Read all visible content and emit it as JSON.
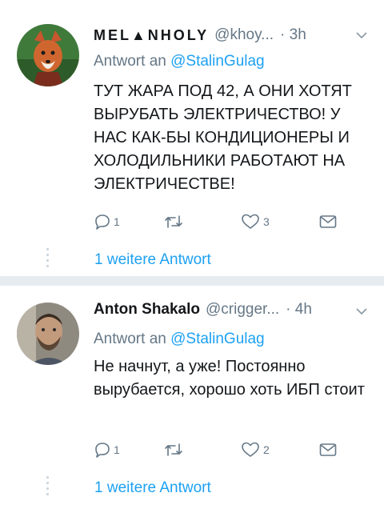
{
  "tweets": [
    {
      "name": "MEL▲NHOLY",
      "handle": "@khoy...",
      "time": "· 3h",
      "reply_prefix": "Antwort an",
      "reply_to": "@StalinGulag",
      "body": "ТУТ ЖАРА ПОД 42, А ОНИ ХОТЯТ ВЫРУБАТЬ ЭЛЕКТРИЧЕСТВО! У НАС КАК-БЫ КОНДИЦИОНЕРЫ И ХОЛОДИЛЬНИКИ РАБОТАЮТ НА ЭЛЕКТРИЧЕСТВЕ!",
      "replies": "1",
      "retweets": "",
      "likes": "3",
      "more_replies": "1 weitere Antwort"
    },
    {
      "name": "Anton Shakalo",
      "handle": "@crigger...",
      "time": "· 4h",
      "reply_prefix": "Antwort an",
      "reply_to": "@StalinGulag",
      "body": "Не начнут, а уже! Постоянно вырубается, хорошо хоть ИБП стоит",
      "replies": "1",
      "retweets": "",
      "likes": "2",
      "more_replies": "1 weitere Antwort"
    }
  ],
  "colors": {
    "link": "#1da1f2",
    "secondary": "#657786",
    "text": "#14171a",
    "separator": "#e6ecf0"
  },
  "icons": [
    "reply-icon",
    "retweet-icon",
    "like-icon",
    "dm-icon",
    "chevron-down-icon"
  ]
}
